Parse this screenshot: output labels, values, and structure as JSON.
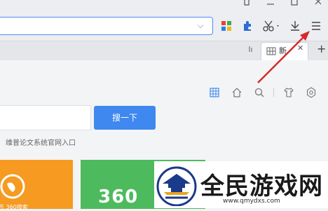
{
  "window": {
    "buttons": [
      {
        "name": "shirt-icon",
        "glyph": "⇧"
      },
      {
        "name": "minimize-button",
        "glyph": "—"
      },
      {
        "name": "maximize-button",
        "glyph": "□"
      },
      {
        "name": "close-button",
        "glyph": "✕"
      }
    ]
  },
  "toolbar": {
    "address_value": "",
    "address_chevron": "⌵",
    "icons": [
      "apps-icon",
      "extension-icon",
      "scissors-icon",
      "download-icon",
      "menu-icon"
    ]
  },
  "tabs": {
    "active_title": "新",
    "close_glyph": "✕",
    "new_tab_glyph": "+"
  },
  "page": {
    "search_button": "搜一下",
    "hint": "维普论文系统官网入口",
    "tile2_text": "360",
    "tile1_text": "吉 360搜索"
  },
  "watermark": {
    "title": "全民游戏网",
    "url": "www.qmydxs.com"
  },
  "colors": {
    "accent": "#3e88f0",
    "arrow": "#d42a2a",
    "tile_orange": "#f69a22",
    "tile_green": "#4dbb5d"
  }
}
